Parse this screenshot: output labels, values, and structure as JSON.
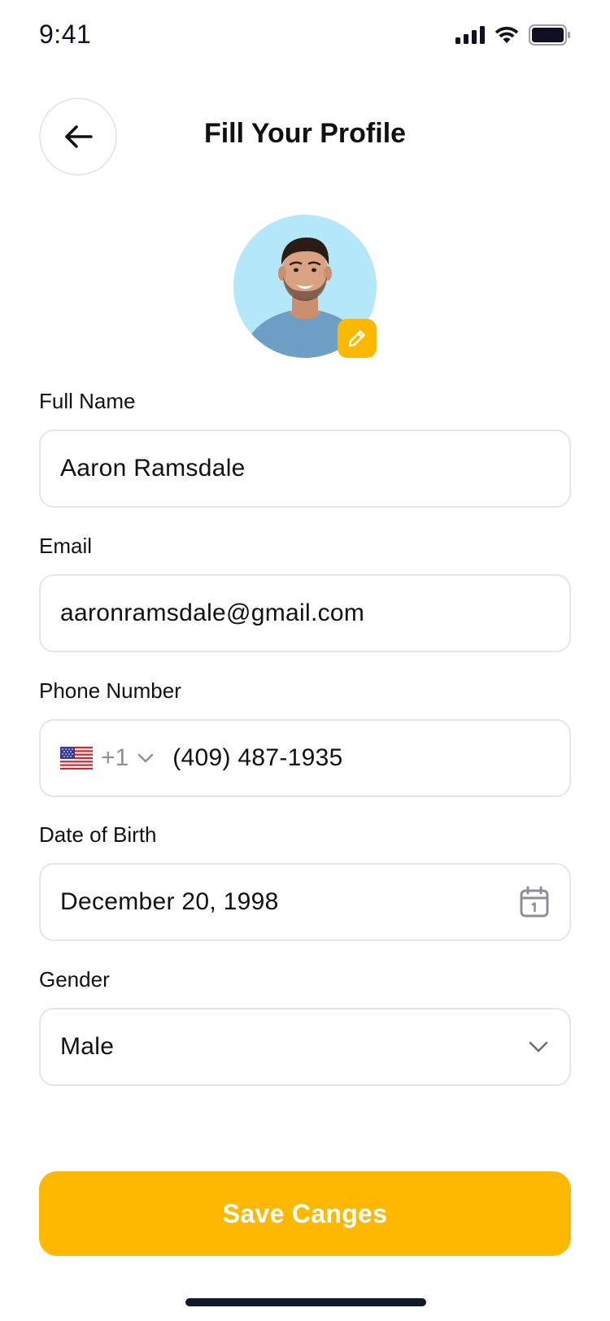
{
  "status_bar": {
    "time": "9:41"
  },
  "header": {
    "title": "Fill Your Profile"
  },
  "form": {
    "full_name": {
      "label": "Full Name",
      "value": "Aaron Ramsdale"
    },
    "email": {
      "label": "Email",
      "value": "aaronramsdale@gmail.com"
    },
    "phone": {
      "label": "Phone Number",
      "country_code": "+1",
      "value": "(409) 487-1935"
    },
    "date_of_birth": {
      "label": "Date of Birth",
      "value": "December 20, 1998"
    },
    "gender": {
      "label": "Gender",
      "value": "Male"
    }
  },
  "actions": {
    "save_label": "Save Canges"
  },
  "colors": {
    "accent": "#ffb800",
    "avatar_bg": "#b4e7f9",
    "border": "#e5e5ea"
  },
  "icons": [
    "signal-icon",
    "wifi-icon",
    "battery-icon",
    "back-arrow-icon",
    "edit-pencil-icon",
    "us-flag-icon",
    "chevron-down-icon",
    "calendar-icon"
  ]
}
